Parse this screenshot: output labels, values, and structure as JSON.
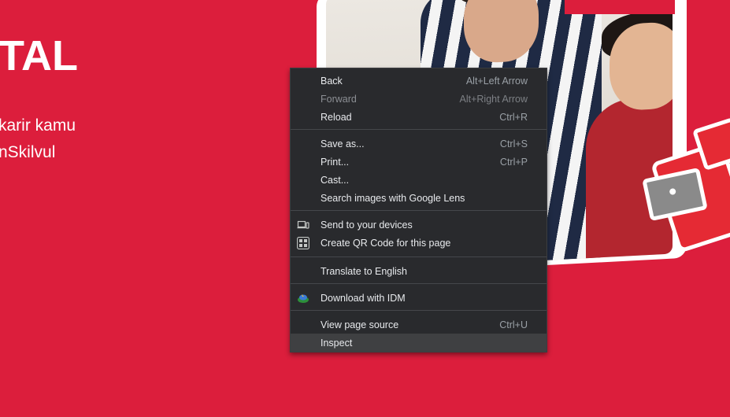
{
  "hero": {
    "title": "TAL",
    "line1": "karir kamu",
    "line2": "nSkilvul"
  },
  "context_menu": {
    "items": [
      {
        "label": "Back",
        "shortcut": "Alt+Left Arrow"
      },
      {
        "label": "Forward",
        "shortcut": "Alt+Right Arrow"
      },
      {
        "label": "Reload",
        "shortcut": "Ctrl+R"
      },
      {
        "label": "Save as...",
        "shortcut": "Ctrl+S"
      },
      {
        "label": "Print...",
        "shortcut": "Ctrl+P"
      },
      {
        "label": "Cast...",
        "shortcut": ""
      },
      {
        "label": "Search images with Google Lens",
        "shortcut": ""
      },
      {
        "label": "Send to your devices",
        "shortcut": "",
        "icon": "devices-icon"
      },
      {
        "label": "Create QR Code for this page",
        "shortcut": "",
        "icon": "qr-code-icon"
      },
      {
        "label": "Translate to English",
        "shortcut": ""
      },
      {
        "label": "Download with IDM",
        "shortcut": "",
        "icon": "idm-icon"
      },
      {
        "label": "View page source",
        "shortcut": "Ctrl+U"
      },
      {
        "label": "Inspect",
        "shortcut": ""
      }
    ]
  },
  "colors": {
    "page_background": "#dc1e3c",
    "menu_background": "#292a2d",
    "menu_text": "#e8eaed",
    "menu_shortcut": "#9aa0a6",
    "menu_highlight": "#3f4042"
  }
}
